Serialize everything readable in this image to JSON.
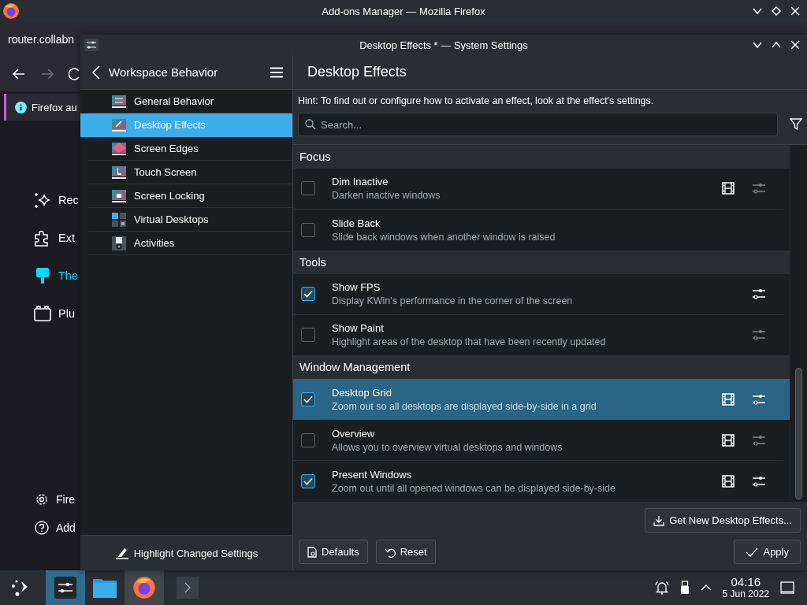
{
  "firefox": {
    "title": "Add-ons Manager — Mozilla Firefox",
    "url": "router.collabn",
    "notice": "Firefox au",
    "sidebar": [
      {
        "label": "Rec",
        "selected": false
      },
      {
        "label": "Ext",
        "selected": false
      },
      {
        "label": "The",
        "selected": true
      },
      {
        "label": "Plu",
        "selected": false
      }
    ],
    "footer": [
      {
        "label": "Fire"
      },
      {
        "label": "Add"
      }
    ]
  },
  "settings": {
    "title": "Desktop Effects * — System Settings",
    "section": "Workspace Behavior",
    "nav_items": [
      {
        "label": "General Behavior",
        "selected": false
      },
      {
        "label": "Desktop Effects",
        "selected": true
      },
      {
        "label": "Screen Edges",
        "selected": false
      },
      {
        "label": "Touch Screen",
        "selected": false
      },
      {
        "label": "Screen Locking",
        "selected": false
      },
      {
        "label": "Virtual Desktops",
        "selected": false
      },
      {
        "label": "Activities",
        "selected": false
      }
    ],
    "highlight_button": "Highlight Changed Settings",
    "page_title": "Desktop Effects",
    "hint": "Hint: To find out or configure how to activate an effect, look at the effect's settings.",
    "search": {
      "placeholder": "Search..."
    },
    "groups": [
      {
        "name": "Focus",
        "effects": [
          {
            "name": "Dim Inactive",
            "description": "Darken inactive windows",
            "checked": false,
            "selected": false,
            "video": true,
            "configure": true
          },
          {
            "name": "Slide Back",
            "description": "Slide back windows when another window is raised",
            "checked": false,
            "selected": false,
            "video": false,
            "configure": false
          }
        ]
      },
      {
        "name": "Tools",
        "effects": [
          {
            "name": "Show FPS",
            "description": "Display KWin's performance in the corner of the screen",
            "checked": true,
            "selected": false,
            "video": false,
            "configure": true
          },
          {
            "name": "Show Paint",
            "description": "Highlight areas of the desktop that have been recently updated",
            "checked": false,
            "selected": false,
            "video": false,
            "configure": true
          }
        ]
      },
      {
        "name": "Window Management",
        "effects": [
          {
            "name": "Desktop Grid",
            "description": "Zoom out so all desktops are displayed side-by-side in a grid",
            "checked": true,
            "selected": true,
            "video": true,
            "configure": true
          },
          {
            "name": "Overview",
            "description": "Allows you to overview virtual desktops and windows",
            "checked": false,
            "selected": false,
            "video": true,
            "configure": true
          },
          {
            "name": "Present Windows",
            "description": "Zoom out until all opened windows can be displayed side-by-side",
            "checked": true,
            "selected": false,
            "video": true,
            "configure": true
          }
        ]
      }
    ],
    "get_new_button": "Get New Desktop Effects...",
    "defaults_button": "Defaults",
    "reset_button": "Reset",
    "apply_button": "Apply"
  },
  "taskbar": {
    "tasks": [
      {
        "kind": "settings",
        "active": true
      },
      {
        "kind": "files",
        "active": false
      },
      {
        "kind": "firefox",
        "active": false,
        "open": true
      }
    ],
    "clock": {
      "time": "04:16",
      "date": "5 Jun 2022"
    }
  }
}
